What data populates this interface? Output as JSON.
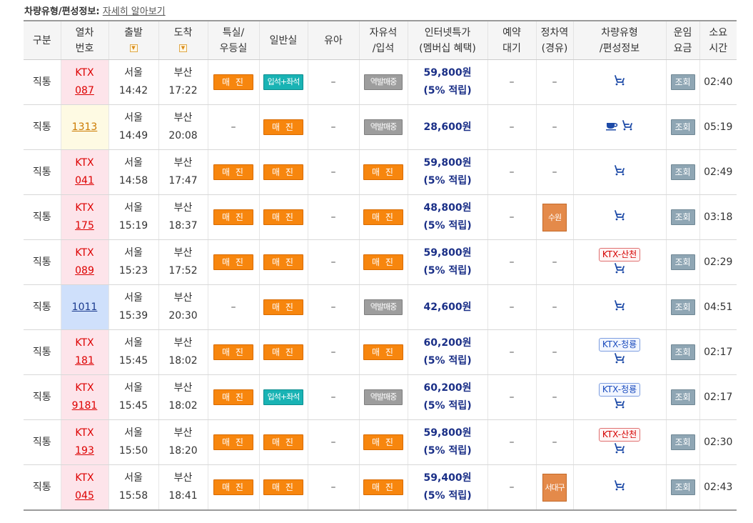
{
  "caption": {
    "title": "차량유형/편성정보:",
    "link": "자세히 알아보기"
  },
  "headers": {
    "category": "구분",
    "train_no": [
      "열차",
      "번호"
    ],
    "depart": "출발",
    "arrive": "도착",
    "special": [
      "특실/",
      "우등실"
    ],
    "general": "일반실",
    "infant": "유아",
    "free_seat": [
      "자유석",
      "/입석"
    ],
    "internet_fare": [
      "인터넷특가",
      "(멤버십 혜택)"
    ],
    "reserve_wait": [
      "예약",
      "대기"
    ],
    "stop_station": [
      "정차역",
      "(경유)"
    ],
    "vehicle_type": [
      "차량유형",
      "/편성정보"
    ],
    "fare": [
      "운임",
      "요금"
    ],
    "duration": [
      "소요",
      "시간"
    ]
  },
  "icons": {
    "sort": "sort-arrow-icon",
    "seat": "wheelchair-seat-icon",
    "cafe": "coffee-cup-icon"
  },
  "colors": {
    "sold_out": "#f7860e",
    "standing": "#19b3b4",
    "station_sale": "#9d9d9d",
    "fare_text": "#1a2f87",
    "ktx_red": "#dd0000"
  },
  "rows": [
    {
      "category": "직통",
      "train_type": "KTX",
      "train_no": "087",
      "depart_station": "서울",
      "depart_time": "14:42",
      "arrive_station": "부산",
      "arrive_time": "17:22",
      "special": "매 진",
      "general": "입석+좌석",
      "infant": "–",
      "free_seat": "역발매중",
      "fare_amount": "59,800원",
      "fare_note": "(5% 적립)",
      "reserve_wait": "–",
      "stop_station": "–",
      "vehicle_badge": "",
      "view": "조회",
      "duration": "02:40"
    },
    {
      "category": "직통",
      "train_type": "",
      "train_no": "1313",
      "depart_station": "서울",
      "depart_time": "14:49",
      "arrive_station": "부산",
      "arrive_time": "20:08",
      "special": "–",
      "general": "매 진",
      "infant": "–",
      "free_seat": "역발매중",
      "fare_amount": "28,600원",
      "fare_note": "",
      "reserve_wait": "–",
      "stop_station": "–",
      "vehicle_badge": "",
      "view": "조회",
      "duration": "05:19"
    },
    {
      "category": "직통",
      "train_type": "KTX",
      "train_no": "041",
      "depart_station": "서울",
      "depart_time": "14:58",
      "arrive_station": "부산",
      "arrive_time": "17:47",
      "special": "매 진",
      "general": "매 진",
      "infant": "–",
      "free_seat": "매 진",
      "fare_amount": "59,800원",
      "fare_note": "(5% 적립)",
      "reserve_wait": "–",
      "stop_station": "–",
      "vehicle_badge": "",
      "view": "조회",
      "duration": "02:49"
    },
    {
      "category": "직통",
      "train_type": "KTX",
      "train_no": "175",
      "depart_station": "서울",
      "depart_time": "15:19",
      "arrive_station": "부산",
      "arrive_time": "18:37",
      "special": "매 진",
      "general": "매 진",
      "infant": "–",
      "free_seat": "매 진",
      "fare_amount": "48,800원",
      "fare_note": "(5% 적립)",
      "reserve_wait": "–",
      "stop_station": "수원",
      "vehicle_badge": "",
      "view": "조회",
      "duration": "03:18"
    },
    {
      "category": "직통",
      "train_type": "KTX",
      "train_no": "089",
      "depart_station": "서울",
      "depart_time": "15:23",
      "arrive_station": "부산",
      "arrive_time": "17:52",
      "special": "매 진",
      "general": "매 진",
      "infant": "–",
      "free_seat": "매 진",
      "fare_amount": "59,800원",
      "fare_note": "(5% 적립)",
      "reserve_wait": "–",
      "stop_station": "–",
      "vehicle_badge": "KTX-산천",
      "view": "조회",
      "duration": "02:29"
    },
    {
      "category": "직통",
      "train_type": "",
      "train_no": "1011",
      "depart_station": "서울",
      "depart_time": "15:39",
      "arrive_station": "부산",
      "arrive_time": "20:30",
      "special": "–",
      "general": "매 진",
      "infant": "–",
      "free_seat": "역발매중",
      "fare_amount": "42,600원",
      "fare_note": "",
      "reserve_wait": "–",
      "stop_station": "–",
      "vehicle_badge": "",
      "view": "조회",
      "duration": "04:51"
    },
    {
      "category": "직통",
      "train_type": "KTX",
      "train_no": "181",
      "depart_station": "서울",
      "depart_time": "15:45",
      "arrive_station": "부산",
      "arrive_time": "18:02",
      "special": "매 진",
      "general": "매 진",
      "infant": "–",
      "free_seat": "매 진",
      "fare_amount": "60,200원",
      "fare_note": "(5% 적립)",
      "reserve_wait": "–",
      "stop_station": "–",
      "vehicle_badge": "KTX-청룡",
      "view": "조회",
      "duration": "02:17"
    },
    {
      "category": "직통",
      "train_type": "KTX",
      "train_no": "9181",
      "depart_station": "서울",
      "depart_time": "15:45",
      "arrive_station": "부산",
      "arrive_time": "18:02",
      "special": "매 진",
      "general": "입석+좌석",
      "infant": "–",
      "free_seat": "역발매중",
      "fare_amount": "60,200원",
      "fare_note": "(5% 적립)",
      "reserve_wait": "–",
      "stop_station": "–",
      "vehicle_badge": "KTX-청룡",
      "view": "조회",
      "duration": "02:17"
    },
    {
      "category": "직통",
      "train_type": "KTX",
      "train_no": "193",
      "depart_station": "서울",
      "depart_time": "15:50",
      "arrive_station": "부산",
      "arrive_time": "18:20",
      "special": "매 진",
      "general": "매 진",
      "infant": "–",
      "free_seat": "매 진",
      "fare_amount": "59,800원",
      "fare_note": "(5% 적립)",
      "reserve_wait": "–",
      "stop_station": "–",
      "vehicle_badge": "KTX-산천",
      "view": "조회",
      "duration": "02:30"
    },
    {
      "category": "직통",
      "train_type": "KTX",
      "train_no": "045",
      "depart_station": "서울",
      "depart_time": "15:58",
      "arrive_station": "부산",
      "arrive_time": "18:41",
      "special": "매 진",
      "general": "매 진",
      "infant": "–",
      "free_seat": "매 진",
      "fare_amount": "59,400원",
      "fare_note": "(5% 적립)",
      "reserve_wait": "–",
      "stop_station": "서대구",
      "vehicle_badge": "",
      "view": "조회",
      "duration": "02:43"
    }
  ]
}
